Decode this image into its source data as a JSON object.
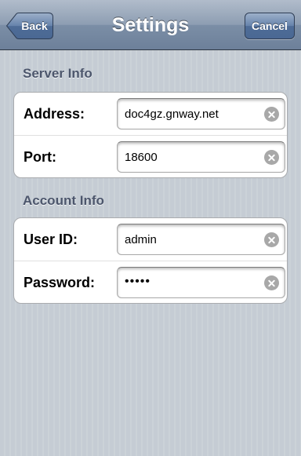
{
  "nav": {
    "title": "Settings",
    "back_label": "Back",
    "cancel_label": "Cancel"
  },
  "sections": {
    "server": {
      "header": "Server Info",
      "address_label": "Address:",
      "address_value": "doc4gz.gnway.net",
      "port_label": "Port:",
      "port_value": "18600"
    },
    "account": {
      "header": "Account Info",
      "userid_label": "User ID:",
      "userid_value": "admin",
      "password_label": "Password:",
      "password_mask": "•••••"
    }
  },
  "colors": {
    "nav_bar": "#7b8ea6",
    "background": "#c5ccd4",
    "section_header": "#4c566c",
    "clear_icon": "#a8a8a8"
  },
  "icons": {
    "clear": "clear-x-icon",
    "back": "back-arrow-button"
  }
}
